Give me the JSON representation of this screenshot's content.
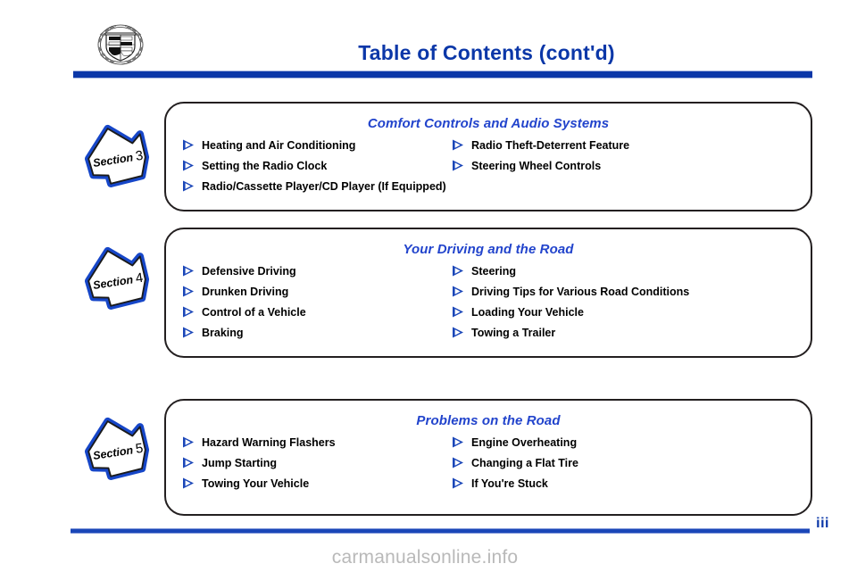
{
  "document": {
    "title": "Table of Contents (cont'd)",
    "page_number": "iii",
    "watermark": "carmanualsonline.info",
    "logo_name": "cadillac-crest-logo",
    "accent_color": "#0b37a8",
    "title_color": "#2244cc",
    "bullet_color": "#1a46b8",
    "rule_color": "#0b37a8"
  },
  "sections": [
    {
      "badge_label": "Section",
      "badge_number": "3",
      "title": "Comfort Controls and Audio Systems",
      "left_items": [
        "Heating and Air Conditioning",
        "Setting the Radio Clock",
        "Radio/Cassette Player/CD Player (If Equipped)"
      ],
      "right_items": [
        "Radio Theft-Deterrent Feature",
        "Steering Wheel Controls"
      ]
    },
    {
      "badge_label": "Section",
      "badge_number": "4",
      "title": "Your Driving and the Road",
      "left_items": [
        "Defensive Driving",
        "Drunken Driving",
        "Control of a Vehicle",
        "Braking"
      ],
      "right_items": [
        "Steering",
        "Driving Tips for Various Road Conditions",
        "Loading Your Vehicle",
        "Towing a Trailer"
      ]
    },
    {
      "badge_label": "Section",
      "badge_number": "5",
      "title": "Problems on the Road",
      "left_items": [
        "Hazard Warning Flashers",
        "Jump Starting",
        "Towing Your Vehicle"
      ],
      "right_items": [
        "Engine Overheating",
        "Changing a Flat Tire",
        "If You're Stuck"
      ]
    }
  ]
}
